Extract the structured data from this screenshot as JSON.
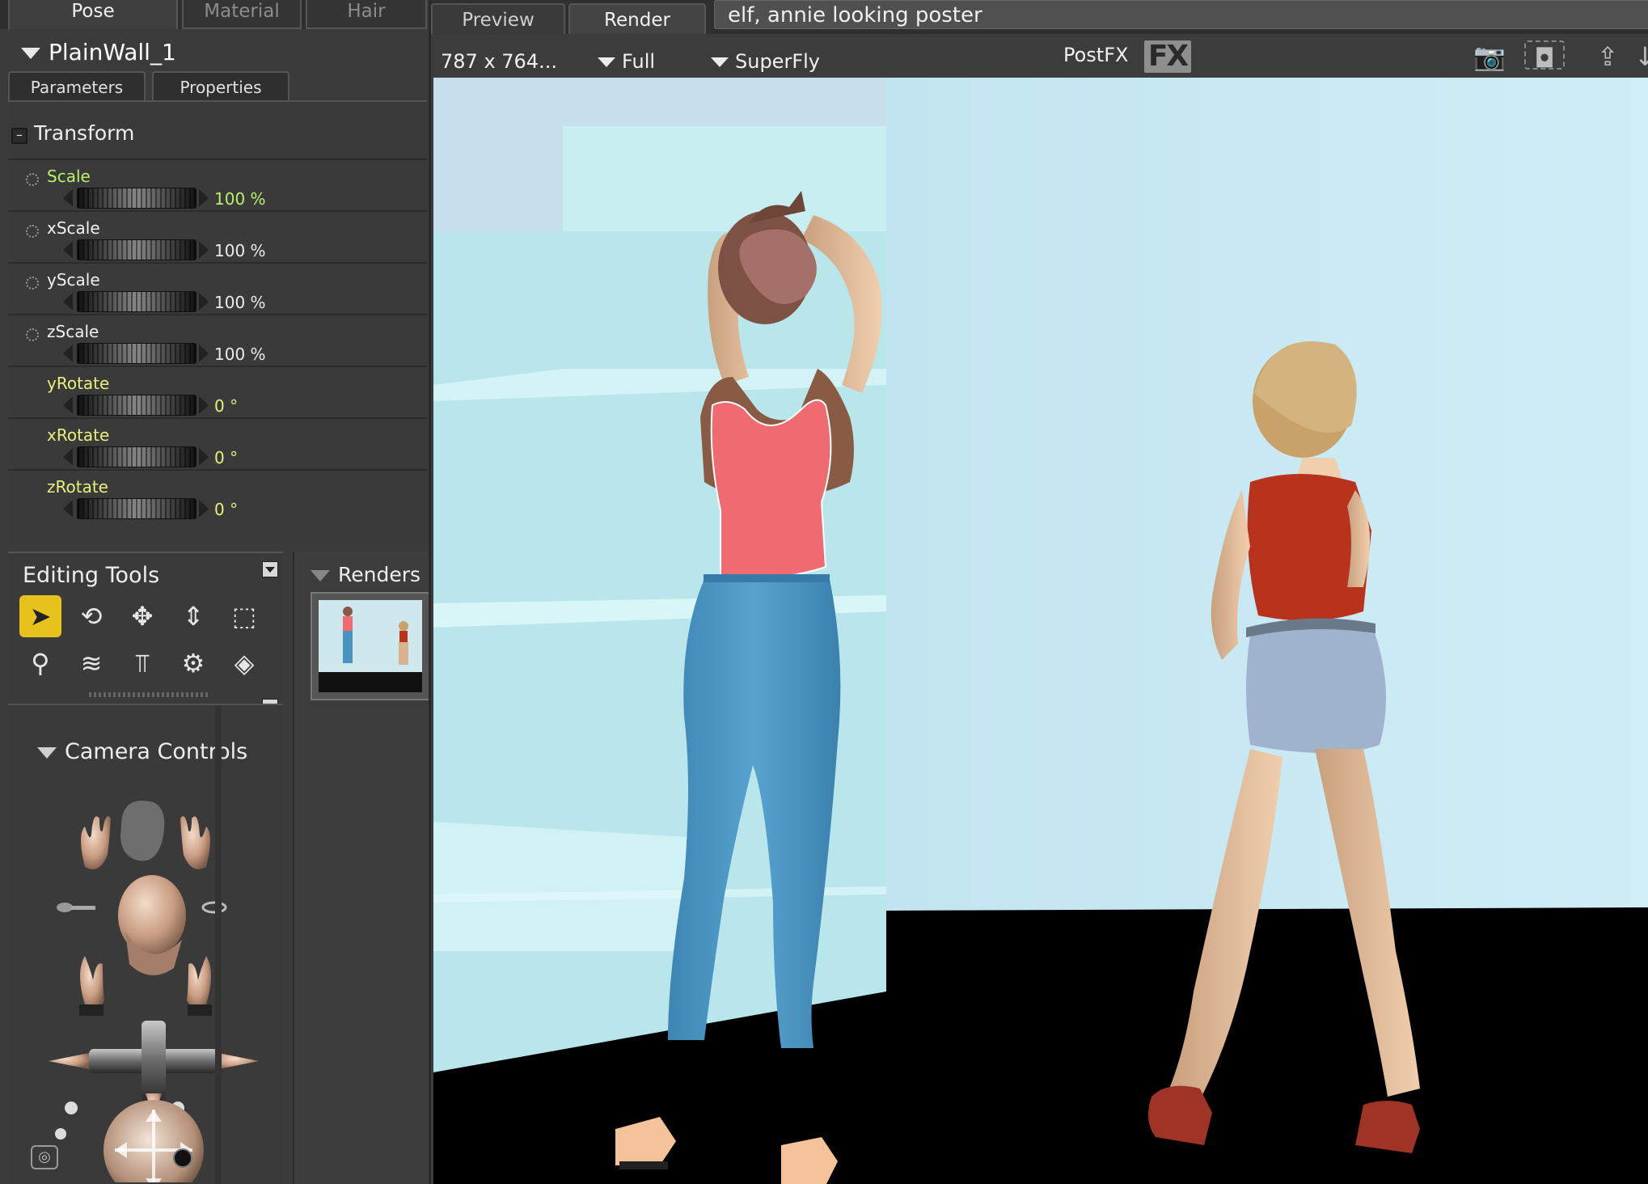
{
  "pose_tabs": [
    "Pose",
    "Material",
    "Hair"
  ],
  "figure": {
    "name": "PlainWall_1"
  },
  "sub_tabs": [
    "Parameters",
    "Properties"
  ],
  "transform": {
    "group_label": "Transform",
    "toggle_symbol": "–",
    "params": [
      {
        "name": "Scale",
        "value": "100 %",
        "highlight": "green"
      },
      {
        "name": "xScale",
        "value": "100 %",
        "highlight": "none"
      },
      {
        "name": "yScale",
        "value": "100 %",
        "highlight": "none"
      },
      {
        "name": "zScale",
        "value": "100 %",
        "highlight": "none"
      },
      {
        "name": "yRotate",
        "value": "0 °",
        "highlight": "yellow"
      },
      {
        "name": "xRotate",
        "value": "0 °",
        "highlight": "yellow"
      },
      {
        "name": "zRotate",
        "value": "0 °",
        "highlight": "yellow"
      }
    ]
  },
  "editing_tools": {
    "title": "Editing Tools",
    "tools": [
      {
        "icon": "select-arrow-icon",
        "glyph": "➤",
        "active": true
      },
      {
        "icon": "rotate-icon",
        "glyph": "⟲",
        "active": false
      },
      {
        "icon": "translate-icon",
        "glyph": "✥",
        "active": false
      },
      {
        "icon": "translate-in-out-icon",
        "glyph": "⇕",
        "active": false
      },
      {
        "icon": "scale-icon",
        "glyph": "⬚",
        "active": false
      },
      {
        "icon": "taper-icon",
        "glyph": "⚲",
        "active": false
      },
      {
        "icon": "twist-icon",
        "glyph": "≋",
        "active": false
      },
      {
        "icon": "chain-break-icon",
        "glyph": "⫪",
        "active": false
      },
      {
        "icon": "direct-manipulation-icon",
        "glyph": "⚙",
        "active": false
      },
      {
        "icon": "color-icon",
        "glyph": "◈",
        "active": false
      }
    ]
  },
  "renders_panel": {
    "title": "Renders"
  },
  "camera_controls": {
    "title": "Camera Controls"
  },
  "view_tabs": [
    "Preview",
    "Render"
  ],
  "render_name": "elf, annie looking poster",
  "render_bar": {
    "size": "787 x 764...",
    "resolution": "Full",
    "engine": "SuperFly",
    "postfx": "PostFX",
    "fx": "FX"
  },
  "colors": {
    "tool_active": "#e8c21c",
    "param_yellow": "#e7f07a",
    "param_green": "#b8f06a",
    "wall": "#cdeaf2",
    "floor": "#000000",
    "top_pink": "#f06a72",
    "jeans_blue": "#4a93c0",
    "top_red": "#b8321c",
    "shorts_denim": "#9fb4cc"
  }
}
